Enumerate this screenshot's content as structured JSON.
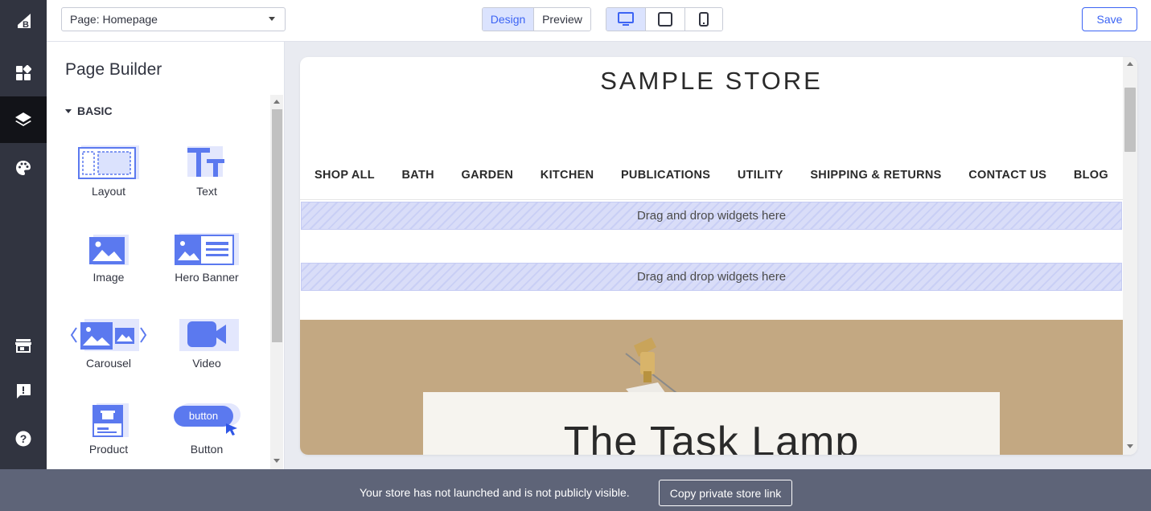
{
  "topbar": {
    "page_select_value": "Page: Homepage",
    "view_modes": [
      "Design",
      "Preview"
    ],
    "active_view_mode": "Design",
    "devices": [
      "desktop-icon",
      "tablet-icon",
      "mobile-icon"
    ],
    "active_device": "desktop-icon",
    "save_label": "Save"
  },
  "rail": {
    "items": [
      "bigcommerce-logo",
      "widgets-icon",
      "layers-icon",
      "palette-icon",
      "storefront-icon",
      "feedback-icon",
      "help-icon"
    ],
    "active": "layers-icon"
  },
  "panel": {
    "title": "Page Builder",
    "section": "BASIC",
    "widgets": [
      {
        "label": "Layout",
        "icon": "layout-icon"
      },
      {
        "label": "Text",
        "icon": "text-icon"
      },
      {
        "label": "Image",
        "icon": "image-icon"
      },
      {
        "label": "Hero Banner",
        "icon": "hero-banner-icon"
      },
      {
        "label": "Carousel",
        "icon": "carousel-icon"
      },
      {
        "label": "Video",
        "icon": "video-icon"
      },
      {
        "label": "Product",
        "icon": "product-icon"
      },
      {
        "label": "Button",
        "icon": "button-icon",
        "icon_text": "button"
      }
    ]
  },
  "preview": {
    "store_title": "SAMPLE STORE",
    "nav": [
      "SHOP ALL",
      "BATH",
      "GARDEN",
      "KITCHEN",
      "PUBLICATIONS",
      "UTILITY",
      "SHIPPING & RETURNS",
      "CONTACT US",
      "BLOG"
    ],
    "dropzones": [
      "Drag and drop widgets here",
      "Drag and drop widgets here"
    ],
    "hero_title": "The Task Lamp"
  },
  "bottombar": {
    "message": "Your store has not launched and is not publicly visible.",
    "link_button": "Copy private store link"
  },
  "colors": {
    "accent": "#3c64f4",
    "rail": "#313440",
    "bottombar": "#5e6478",
    "hero": "#c3a882"
  }
}
